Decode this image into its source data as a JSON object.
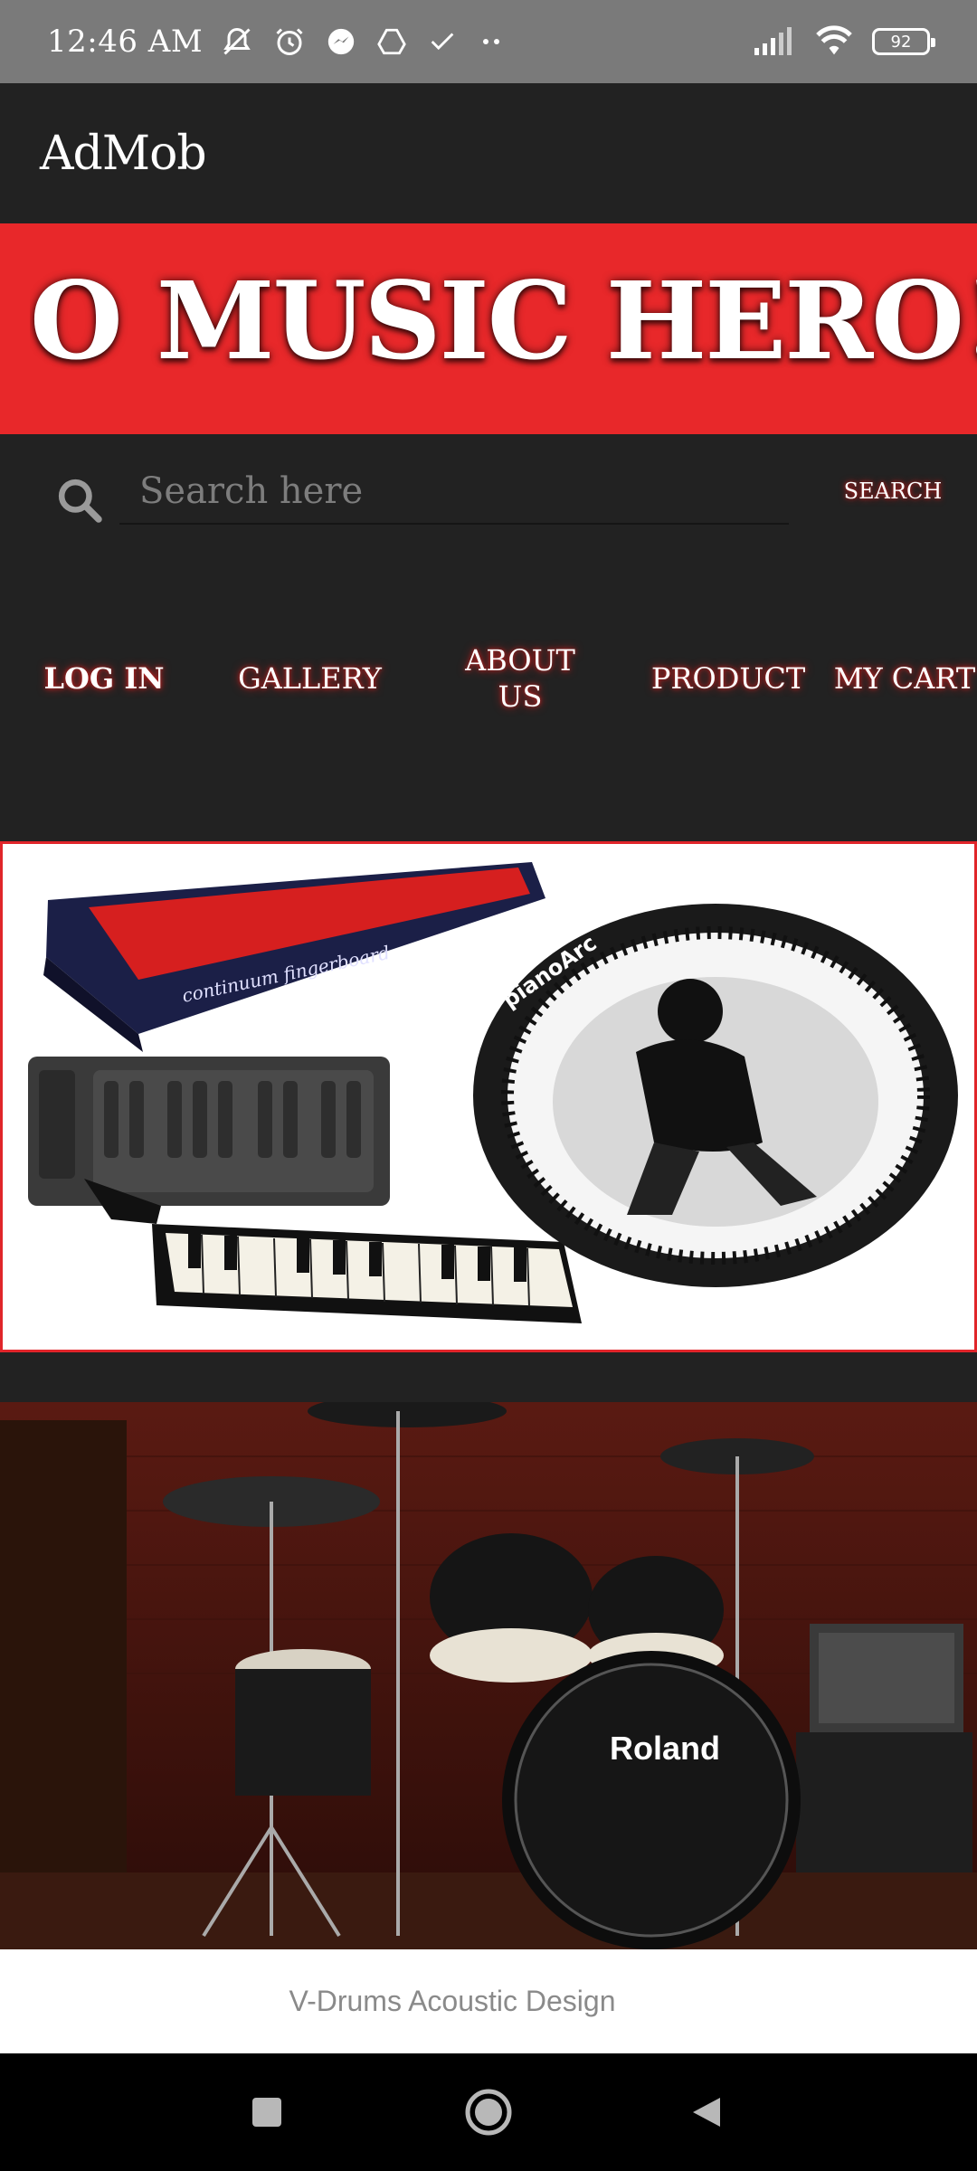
{
  "status_bar": {
    "time": "12:46 AM",
    "battery": "92",
    "icons": [
      "mute-icon",
      "alarm-icon",
      "messenger-icon",
      "drive-icon",
      "check-icon",
      "more-icon",
      "signal-icon",
      "wifi-icon",
      "battery-icon"
    ]
  },
  "app_bar": {
    "title": "AdMob"
  },
  "banner": {
    "text": "O MUSIC HERO!"
  },
  "search": {
    "placeholder": "Search here",
    "button_label": "SEARCH"
  },
  "nav": {
    "login": "LOG IN",
    "gallery": "GALLERY",
    "about_line1": "ABOUT",
    "about_line2": "US",
    "product": "PRODUCT",
    "cart": "MY CART"
  },
  "instrument_card": {
    "labels": {
      "fingerboard": "continuum fingerboard",
      "piano_arc": "pianoArc"
    }
  },
  "drum_card": {
    "brand": "Roland",
    "caption": "V-Drums Acoustic Design"
  },
  "colors": {
    "accent": "#e8282a",
    "background": "#222222",
    "status_bar": "#7a7a7a"
  }
}
